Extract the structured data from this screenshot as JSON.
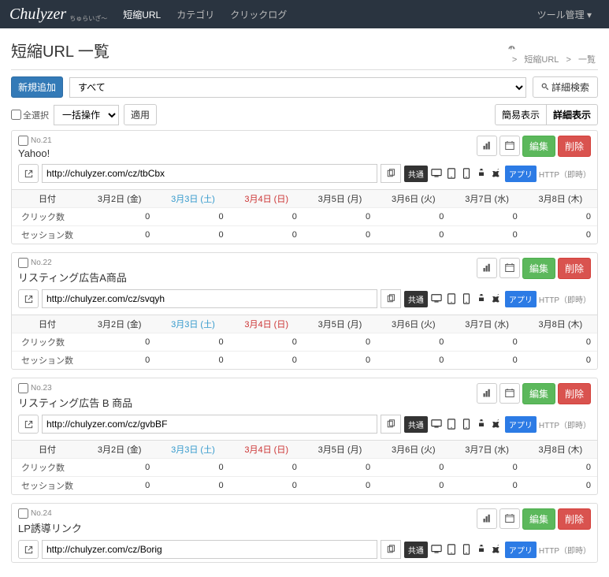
{
  "nav": {
    "logo": "Chulyzer",
    "logo_sub": "ちゅらいざ～",
    "items": [
      "短縮URL",
      "カテゴリ",
      "クリックログ"
    ],
    "tool": "ツール管理",
    "tool_caret": "▾"
  },
  "header": {
    "title": "短縮URL 一覧",
    "breadcrumb": {
      "mid": "短縮URL",
      "last": "一覧",
      "sep": ">"
    }
  },
  "toolbar": {
    "add_new": "新規追加",
    "category_selected": "すべて",
    "search": "詳細検索"
  },
  "bulk": {
    "select_all": "全選択",
    "bulk_action": "一括操作",
    "apply": "適用",
    "view_simple": "簡易表示",
    "view_detail": "詳細表示"
  },
  "labels": {
    "edit": "編集",
    "delete": "削除",
    "common": "共通",
    "app": "アプリ",
    "http": "HTTP（即時）",
    "date": "日付",
    "clicks": "クリック数",
    "sessions": "セッション数"
  },
  "dates": [
    {
      "label": "3月2日 (金)",
      "cls": ""
    },
    {
      "label": "3月3日 (土)",
      "cls": "sat"
    },
    {
      "label": "3月4日 (日)",
      "cls": "sun"
    },
    {
      "label": "3月5日 (月)",
      "cls": ""
    },
    {
      "label": "3月6日 (火)",
      "cls": ""
    },
    {
      "label": "3月7日 (水)",
      "cls": ""
    },
    {
      "label": "3月8日 (木)",
      "cls": ""
    }
  ],
  "items": [
    {
      "no": "No.21",
      "title": "Yahoo!",
      "url": "http://chulyzer.com/cz/tbCbx",
      "clicks": [
        0,
        0,
        0,
        0,
        0,
        0,
        0
      ],
      "sessions": [
        0,
        0,
        0,
        0,
        0,
        0,
        0
      ]
    },
    {
      "no": "No.22",
      "title": "リスティング広告A商品",
      "url": "http://chulyzer.com/cz/svqyh",
      "clicks": [
        0,
        0,
        0,
        0,
        0,
        0,
        0
      ],
      "sessions": [
        0,
        0,
        0,
        0,
        0,
        0,
        0
      ]
    },
    {
      "no": "No.23",
      "title": "リスティング広告 B 商品",
      "url": "http://chulyzer.com/cz/gvbBF",
      "clicks": [
        0,
        0,
        0,
        0,
        0,
        0,
        0
      ],
      "sessions": [
        0,
        0,
        0,
        0,
        0,
        0,
        0
      ]
    },
    {
      "no": "No.24",
      "title": "LP誘導リンク",
      "url": "http://chulyzer.com/cz/Borig",
      "clicks": [],
      "sessions": []
    }
  ]
}
